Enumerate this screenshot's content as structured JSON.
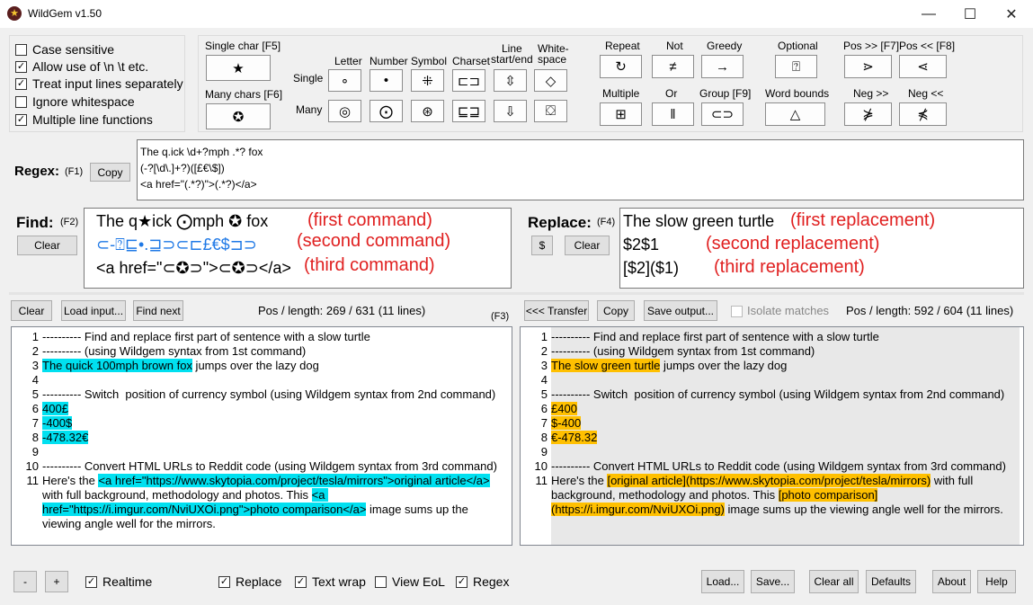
{
  "window": {
    "title": "WildGem v1.50",
    "min": "—",
    "max": "☐",
    "close": "✕"
  },
  "options": [
    {
      "label": "Case sensitive",
      "checked": false
    },
    {
      "label": "Allow use of \\n \\t etc.",
      "checked": true
    },
    {
      "label": "Treat input lines separately",
      "checked": true
    },
    {
      "label": "Ignore whitespace",
      "checked": false
    },
    {
      "label": "Multiple line functions",
      "checked": true
    }
  ],
  "palette": {
    "single_char": "Single char [F5]",
    "many_chars": "Many chars [F6]",
    "single_char_sym": "★",
    "many_chars_sym": "✪",
    "row_single": "Single",
    "row_many": "Many",
    "col_letter": "Letter",
    "col_number": "Number",
    "col_symbol": "Symbol",
    "col_charset": "Charset",
    "col_line": "Line\nstart/end",
    "col_whitespace": "White-\nspace",
    "sym_letter_single": "∘",
    "sym_number_single": "•",
    "sym_symbol_single": "⁜",
    "sym_charset_single": "⊏⊐",
    "sym_line_single": "⇳",
    "sym_whitespace_single": "◇",
    "sym_letter_many": "◎",
    "sym_number_many": "⨀",
    "sym_symbol_many": "⊛",
    "sym_charset_many": "⊑⊒",
    "sym_line_many": "⇩",
    "sym_whitespace_many": "⛋",
    "repeat": "Repeat",
    "not": "Not",
    "greedy": "Greedy",
    "optional": "Optional",
    "pos_fwd": "Pos >> [F7]",
    "pos_back": "Pos << [F8]",
    "multiple": "Multiple",
    "or": "Or",
    "group": "Group [F9]",
    "word_bounds": "Word bounds",
    "neg_fwd": "Neg >>",
    "neg_back": "Neg <<",
    "sym_repeat": "↻",
    "sym_not": "≠",
    "sym_greedy": "→",
    "sym_optional": "⍰",
    "sym_pos_fwd": "⋗",
    "sym_pos_back": "⋖",
    "sym_multiple": "⊞",
    "sym_or": "‖",
    "sym_group": "⊂⊃",
    "sym_word": "△",
    "sym_neg_fwd": "⋡",
    "sym_neg_back": "⋠"
  },
  "regex": {
    "label": "Regex:",
    "fkey": "(F1)",
    "copy": "Copy",
    "lines": [
      "The q.ick \\d+?mph .*? fox",
      "(-?[\\d\\.]+?)([£€\\$])",
      "<a href=\"(.*?)\">(.*?)</a>"
    ]
  },
  "find": {
    "label": "Find:",
    "fkey": "(F2)",
    "clear": "Clear",
    "line1": "The q★ick ⨀mph ✪ fox",
    "line2": "⊂-⍰⊑•.⊒⊃⊂⊏£€$⊐⊃",
    "line3": "<a href=\"⊂✪⊃\">⊂✪⊃</a>",
    "note1": "(first command)",
    "note2": "(second command)",
    "note3": "(third command)"
  },
  "replace": {
    "label": "Replace:",
    "fkey": "(F4)",
    "dollar": "$",
    "clear": "Clear",
    "line1": "The slow green turtle",
    "line2": "$2$1",
    "line3": "[$2]($1)",
    "note1": "(first replacement)",
    "note2": "(second replacement)",
    "note3": "(third replacement)"
  },
  "input_toolbar": {
    "clear": "Clear",
    "load": "Load input...",
    "find_next": "Find next",
    "pos": "Pos / length: 269 / 631 (11 lines)",
    "fkey": "(F3)"
  },
  "output_toolbar": {
    "transfer": "<<< Transfer",
    "copy": "Copy",
    "save": "Save output...",
    "isolate": "Isolate matches",
    "pos": "Pos / length: 592 / 604 (11 lines)"
  },
  "input_lines": {
    "l1": "---------- Find and replace first part of sentence with a slow turtle",
    "l2": "---------- (using Wildgem syntax from 1st command)",
    "l3_hl": "The quick 100mph brown fox",
    "l3_rest": " jumps over the lazy dog",
    "l5": "---------- Switch  position of currency symbol (using Wildgem syntax from 2nd command)",
    "l6": "400£",
    "l7": "-400$",
    "l8": "-478.32€",
    "l10": "---------- Convert HTML URLs to Reddit code (using Wildgem syntax from 3rd command)",
    "l11_a": "Here's the ",
    "l11_hl1": "<a href=\"https://www.skytopia.com/project/tesla/mirrors\">original article</a>",
    "l11_b": " with full background, methodology and photos. This ",
    "l11_hl2": "<a href=\"https://i.imgur.com/NviUXOi.png\">photo comparison</a>",
    "l11_c": " image sums up the viewing angle well for the mirrors."
  },
  "output_lines": {
    "l1": "---------- Find and replace first part of sentence with a slow turtle",
    "l2": "---------- (using Wildgem syntax from 1st command)",
    "l3_hl": "The slow green turtle",
    "l3_rest": " jumps over the lazy dog",
    "l5": "---------- Switch  position of currency symbol (using Wildgem syntax from 2nd command)",
    "l6": "£400",
    "l7": "$-400",
    "l8": "€-478.32",
    "l10": "---------- Convert HTML URLs to Reddit code (using Wildgem syntax from 3rd command)",
    "l11_a": "Here's the ",
    "l11_hl1": "[original article](https://www.skytopia.com/project/tesla/mirrors)",
    "l11_b": " with full background, methodology and photos. This ",
    "l11_hl2": "[photo comparison](https://i.imgur.com/NviUXOi.png)",
    "l11_c": " image sums up the viewing angle well for the mirrors."
  },
  "line_numbers": [
    "1",
    "2",
    "3",
    "4",
    "5",
    "6",
    "7",
    "8",
    "9",
    "10",
    "11"
  ],
  "bottom": {
    "minus": "-",
    "plus": "+",
    "realtime": "Realtime",
    "replace": "Replace",
    "textwrap": "Text wrap",
    "vieweol": "View EoL",
    "regex": "Regex",
    "load": "Load...",
    "save": "Save...",
    "clear_all": "Clear all",
    "defaults": "Defaults",
    "about": "About",
    "help": "Help"
  }
}
